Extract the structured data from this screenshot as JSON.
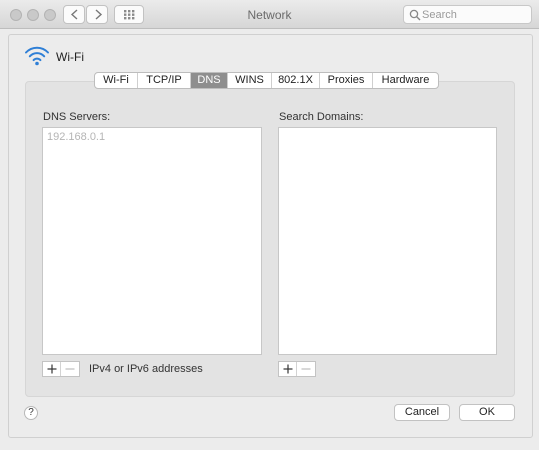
{
  "window": {
    "title": "Network",
    "search_placeholder": "Search"
  },
  "interface": {
    "name": "Wi-Fi",
    "icon": "wifi-icon"
  },
  "tabs": [
    {
      "label": "Wi-Fi",
      "active": false
    },
    {
      "label": "TCP/IP",
      "active": false
    },
    {
      "label": "DNS",
      "active": true
    },
    {
      "label": "WINS",
      "active": false
    },
    {
      "label": "802.1X",
      "active": false
    },
    {
      "label": "Proxies",
      "active": false
    },
    {
      "label": "Hardware",
      "active": false
    }
  ],
  "dns": {
    "servers_label": "DNS Servers:",
    "servers": [
      "192.168.0.1"
    ],
    "domains_label": "Search Domains:",
    "domains": [],
    "hint": "IPv4 or IPv6 addresses"
  },
  "footer": {
    "help": "?",
    "cancel": "Cancel",
    "ok": "OK"
  }
}
